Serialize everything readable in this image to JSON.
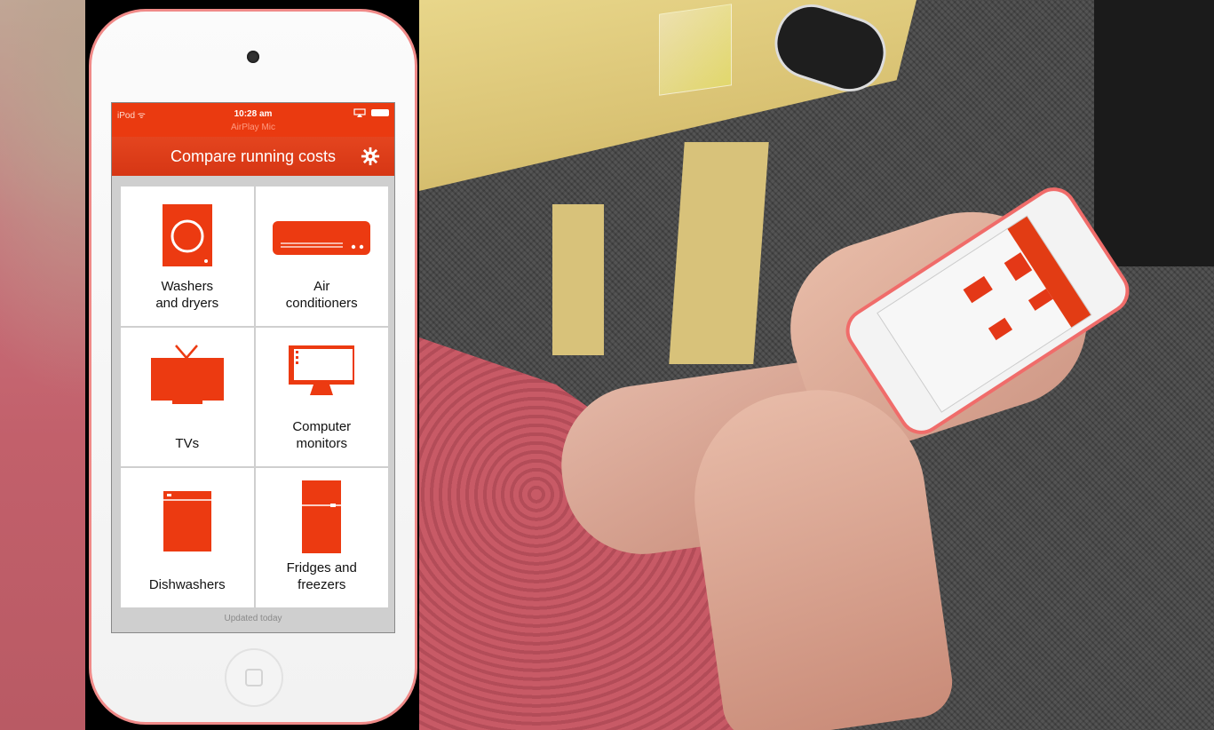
{
  "status_bar": {
    "carrier": "iPod ᯤ",
    "time": "10:28 am",
    "airplay": "AirPlay Mic"
  },
  "nav": {
    "title": "Compare running costs",
    "settings_icon": "gear-icon"
  },
  "categories": [
    {
      "label": "Washers\nand dryers",
      "icon": "washer-icon"
    },
    {
      "label": "Air\nconditioners",
      "icon": "air-conditioner-icon"
    },
    {
      "label": "TVs",
      "icon": "tv-icon"
    },
    {
      "label": "Computer\nmonitors",
      "icon": "monitor-icon"
    },
    {
      "label": "Dishwashers",
      "icon": "dishwasher-icon"
    },
    {
      "label": "Fridges and\nfreezers",
      "icon": "fridge-icon"
    }
  ],
  "footer": {
    "updated": "Updated today"
  },
  "colors": {
    "accent": "#ea3a10",
    "device_trim": "#f08a88"
  }
}
